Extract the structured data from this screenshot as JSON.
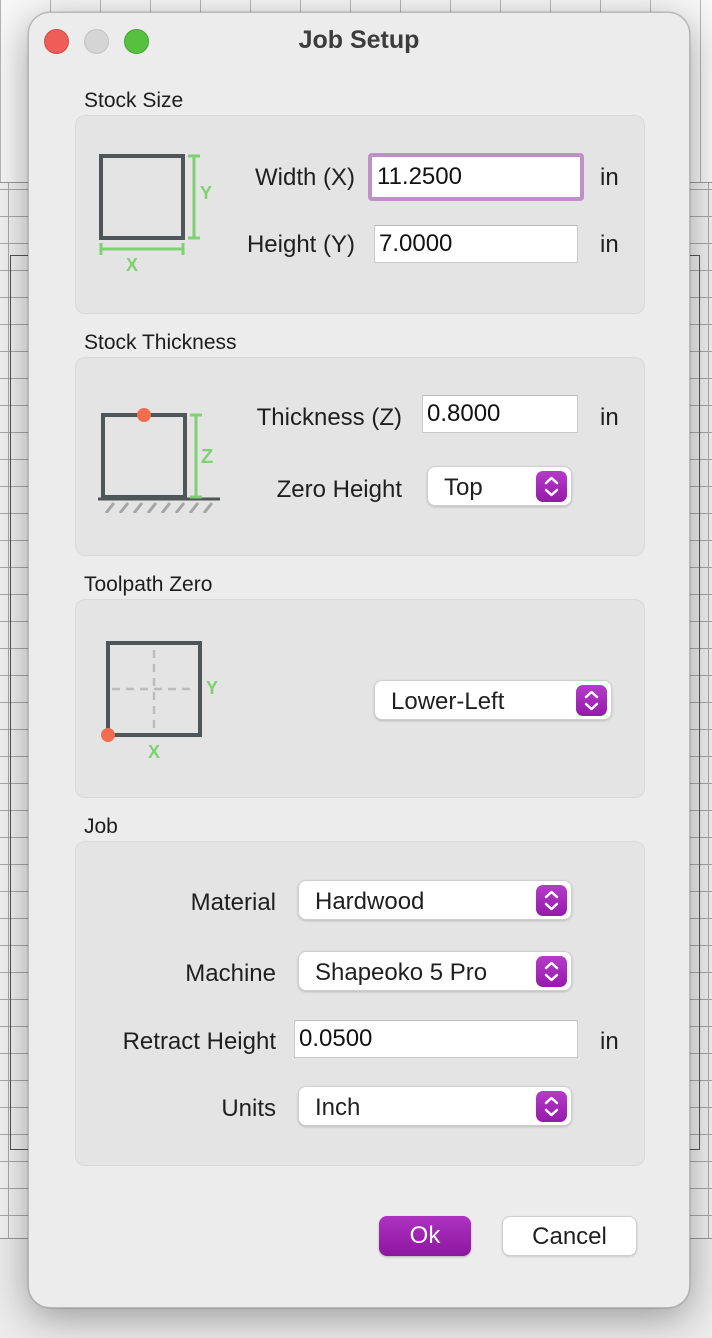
{
  "window": {
    "title": "Job Setup"
  },
  "stock_size": {
    "label": "Stock Size",
    "width_label": "Width (X)",
    "width_value": "11.2500",
    "height_label": "Height (Y)",
    "height_value": "7.0000",
    "unit": "in",
    "diagram_x": "X",
    "diagram_y": "Y"
  },
  "stock_thickness": {
    "label": "Stock Thickness",
    "thickness_label": "Thickness (Z)",
    "thickness_value": "0.8000",
    "unit": "in",
    "zero_height_label": "Zero Height",
    "zero_height_value": "Top",
    "diagram_z": "Z"
  },
  "toolpath_zero": {
    "label": "Toolpath Zero",
    "value": "Lower-Left",
    "diagram_x": "X",
    "diagram_y": "Y"
  },
  "job": {
    "label": "Job",
    "material_label": "Material",
    "material_value": "Hardwood",
    "machine_label": "Machine",
    "machine_value": "Shapeoko 5 Pro",
    "retract_label": "Retract Height",
    "retract_value": "0.0500",
    "retract_unit": "in",
    "units_label": "Units",
    "units_value": "Inch"
  },
  "buttons": {
    "ok": "Ok",
    "cancel": "Cancel"
  },
  "colors": {
    "accent": "#a126b5",
    "focus_ring": "#bf90c7",
    "diagram_green": "#7fcf73",
    "zero_marker": "#f26d4f"
  }
}
